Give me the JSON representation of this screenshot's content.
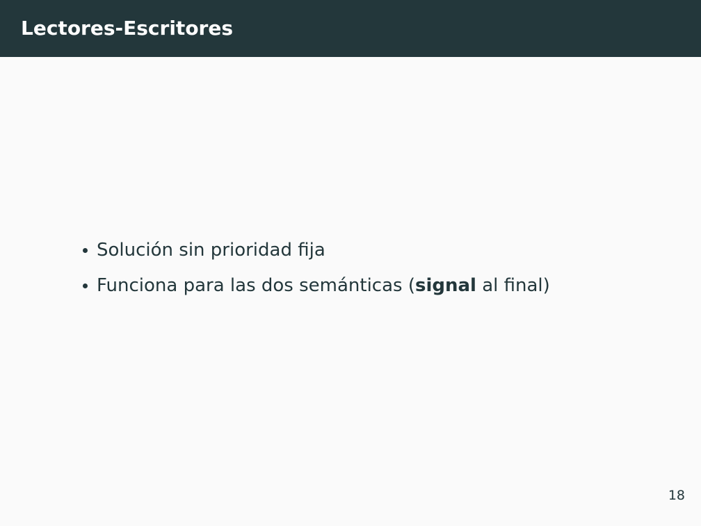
{
  "slide": {
    "title": "Lectores-Escritores",
    "bullets": [
      {
        "text": "Solución sin prioridad fija"
      },
      {
        "before": "Funciona para las dos semánticas (",
        "emphasis": "signal",
        "after": " al final)"
      }
    ],
    "page_number": "18"
  },
  "colors": {
    "title_bar": "#23373b",
    "background": "#fafafa",
    "text": "#23373b"
  }
}
